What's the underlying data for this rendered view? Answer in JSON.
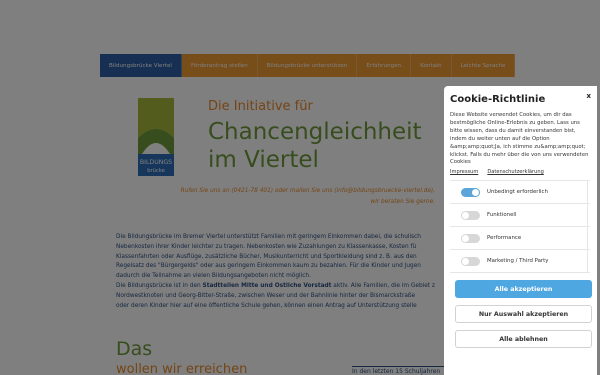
{
  "nav": {
    "items": [
      {
        "label": "Bildungsbrücke Viertel",
        "active": true
      },
      {
        "label": "Förderantrag stellen"
      },
      {
        "label": "Bildungsbrücke unterstützen"
      },
      {
        "label": "Erfahrungen"
      },
      {
        "label": "Kontakt"
      },
      {
        "label": "Leichte Sprache"
      }
    ]
  },
  "logo": {
    "text_line1": "BILDUNGS",
    "text_line2": "brücke"
  },
  "hero": {
    "intro": "Die Initiative für",
    "headline_line1": "Chancengleichheit",
    "headline_line2": "im Viertel",
    "callout_line1": "Rufen Sie uns an (0421-78 401) oder mailen Sie uns (info@bildungsbruecke-viertel.de),",
    "callout_line2": "wir beraten Sie gerne."
  },
  "body": {
    "line1": "Die Bildungsbrücke im Bremer Viertel unterstützt Familien mit geringem Einkommen dabei, die schulisch",
    "line2": "Nebenkosten ihrer Kinder leichter zu tragen. Nebenkosten wie Zuzahlungen zu Klassenkasse, Kosten fü",
    "line3": "Klassenfahrten oder Ausflüge, zusätzliche Bücher, Musikunterricht und Sportkleidung sind z. B. aus den",
    "line4": "Regelsatz des \"Bürgergelds\" oder aus geringem Einkommen kaum zu bezahlen. Für die Kinder und Jugen",
    "line5": "dadurch die Teilnahme an vielen Bildungsangeboten nicht möglich.",
    "line6_pre": "Die Bildungsbrücke ist in den ",
    "line6_bold": "Stadtteilen Mitte und Östliche Vorstadt",
    "line6_post": " aktiv. Alle Familien, die im Gebiet z",
    "line7": "Nordwestknoten und Georg-Bitter-Straße, zwischen Weser und der Bahnlinie hinter der Bismarckstraße",
    "line8": "oder deren Kinder hier auf eine öffentliche Schule gehen, können einen Antrag auf Unterstützung stelle"
  },
  "section": {
    "title": "Das",
    "subtitle": "wollen wir erreichen",
    "stats_label": "In den letzten 15 Schuljahren"
  },
  "cookie": {
    "title": "Cookie-Richtlinie",
    "close": "x",
    "description": "Diese Website verwendet Cookies, um dir das bestmögliche Online-Erlebnis zu geben. Lass uns bitte wissen, dass du damit einverstanden bist, indem du weiter unten auf die Option &amp;amp;quot;Ja, ich stimme zu&amp;amp;quot; klickst. Falls du mehr über die von uns verwendeten Cookies",
    "impressum": "Impressum",
    "privacy": "Datenschutzerklärung",
    "categories": [
      {
        "label": "Unbedingt erforderlich",
        "enabled": true
      },
      {
        "label": "Funktionell",
        "enabled": false
      },
      {
        "label": "Performance",
        "enabled": false
      },
      {
        "label": "Marketing / Third Party",
        "enabled": false
      }
    ],
    "accept_all": "Alle akzeptieren",
    "accept_selection": "Nur Auswahl akzeptieren",
    "reject_all": "Alle ablehnen"
  },
  "colors": {
    "nav_active": "#2f5ea4",
    "nav_orange": "#ee9a33",
    "green": "#6e9a3a",
    "orange": "#e98a2b",
    "blue_text": "#2d4f80",
    "accept_blue": "#4fa7e2"
  }
}
